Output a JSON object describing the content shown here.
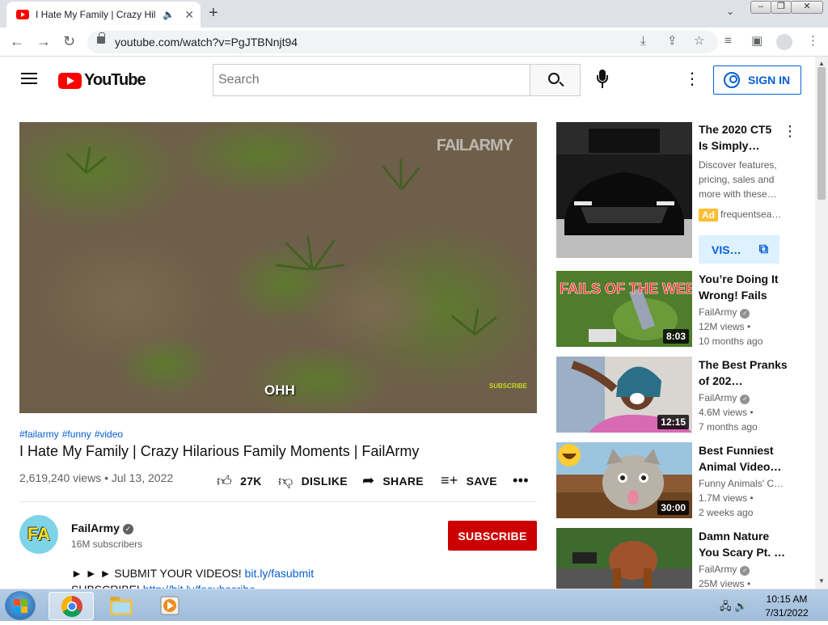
{
  "browser": {
    "tab_title": "I Hate My Family | Crazy Hila",
    "url": "youtube.com/watch?v=PgJTBNnjt94"
  },
  "youtube": {
    "logo_text": "YouTube",
    "search_placeholder": "Search",
    "sign_in": "SIGN IN"
  },
  "video": {
    "watermark": "FAILARMY",
    "caption": "OHH",
    "sub_watermark": "SUBSCRIBE",
    "hashtags": [
      "#failarmy",
      "#funny",
      "#video"
    ],
    "title": "I Hate My Family | Crazy Hilarious Family Moments | FailArmy",
    "views_date": "2,619,240 views • Jul 13, 2022",
    "likes": "27K",
    "dislike": "DISLIKE",
    "share": "SHARE",
    "save": "SAVE",
    "channel_name": "FailArmy",
    "channel_avatar": "FA",
    "subscribers": "16M subscribers",
    "subscribe": "SUBSCRIBE",
    "desc_line1_text": "► ► ► SUBMIT YOUR VIDEOS! ",
    "desc_line1_link": "bit.ly/fasubmit",
    "desc_line2_text": "SUBSCRIBE! ",
    "desc_line2_link": "http://bit.ly/fasubscribe"
  },
  "ad": {
    "title": "The 2020 CT5 Is Simply…",
    "description": "Discover features, pricing, sales and more with these…",
    "badge": "Ad",
    "domain": "frequentsea…",
    "button": "VIS…"
  },
  "recommendations": [
    {
      "title": "You’re Doing It Wrong! Fails o…",
      "channel": "FailArmy",
      "verified": true,
      "views": "12M views •",
      "age": "10 months ago",
      "duration": "8:03",
      "overlay": "FAILS OF THE WEEK"
    },
    {
      "title": "The Best Pranks of 202…",
      "channel": "FailArmy",
      "verified": true,
      "views": "4.6M views •",
      "age": "7 months ago",
      "duration": "12:15"
    },
    {
      "title": "Best Funniest Animal Video…",
      "channel": "Funny Animals' C…",
      "verified": false,
      "views": "1.7M views •",
      "age": "2 weeks ago",
      "duration": "30:00"
    },
    {
      "title": "Damn Nature You Scary Pt. …",
      "channel": "FailArmy",
      "verified": true,
      "views": "25M views •",
      "age": "",
      "duration": ""
    }
  ],
  "taskbar": {
    "time": "10:15 AM",
    "date": "7/31/2022"
  },
  "colors": {
    "youtube_red": "#ff0000",
    "subscribe_red": "#cc0000",
    "link_blue": "#065fd4",
    "ad_yellow": "#fcbd31"
  }
}
